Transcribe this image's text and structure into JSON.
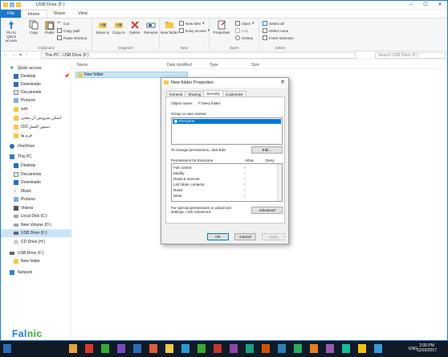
{
  "window": {
    "title": "USB Drive (F:)"
  },
  "ribbon_tabs": [
    "File",
    "Home",
    "Share",
    "View"
  ],
  "ribbon": {
    "clipboard": {
      "pin": "Pin to Quick access",
      "copy": "Copy",
      "paste": "Paste",
      "cut": "Cut",
      "copy_path": "Copy path",
      "paste_shortcut": "Paste shortcut",
      "label": "Clipboard"
    },
    "organize": {
      "move_to": "Move to",
      "copy_to": "Copy to",
      "delete": "Delete",
      "rename": "Rename",
      "label": "Organize"
    },
    "new": {
      "new_folder": "New folder",
      "new_item": "New item",
      "easy_access": "Easy access",
      "label": "New"
    },
    "open": {
      "properties": "Properties",
      "open": "Open",
      "edit": "Edit",
      "history": "History",
      "label": "Open"
    },
    "select": {
      "select_all": "Select all",
      "select_none": "Select none",
      "invert": "Invert selection",
      "label": "Select"
    }
  },
  "address": {
    "path": "This PC  ›  USB Drive (F:)",
    "search_placeholder": "Search USB Drive (F:)",
    "up": "↑"
  },
  "nav": {
    "quick_access": "Quick access",
    "items": [
      "Desktop",
      "Downloads",
      "Documents",
      "Pictures",
      "soft",
      "اسکن سرویس ان مختی",
      "ISO دستور العمل",
      "فرم ها"
    ],
    "onedrive": "OneDrive",
    "this_pc": "This PC",
    "pc_items": [
      "Desktop",
      "Documents",
      "Downloads",
      "Music",
      "Pictures",
      "Videos",
      "Local Disk (C:)",
      "New Volume (D:)",
      "USB Drive (F:)",
      "CD Drive (H:)"
    ],
    "usb": "USB Drive (F:)",
    "usb_child": "New folder",
    "network": "Network"
  },
  "columns": [
    "Name",
    "Date modified",
    "Type",
    "Size"
  ],
  "rows": [
    {
      "name": "New folder"
    }
  ],
  "dialog": {
    "title": "New folder Properties",
    "tabs": [
      "General",
      "Sharing",
      "Security",
      "Customize"
    ],
    "object_name_label": "Object name:",
    "object_name": "F:\\New folder",
    "group_label": "Group or user names:",
    "group_selected": "Everyone",
    "change_text": "To change permissions, click Edit.",
    "edit_button": "Edit...",
    "perm_label": "Permissions for Everyone",
    "allow": "Allow",
    "deny": "Deny",
    "permissions": [
      "Full control",
      "Modify",
      "Read & execute",
      "List folder contents",
      "Read",
      "Write"
    ],
    "special_text": "For special permissions or advanced settings, click Advanced.",
    "advanced_button": "Advanced",
    "ok": "OK",
    "cancel": "Cancel",
    "apply": "Apply"
  },
  "taskbar": {
    "lang": "ENG",
    "time": "2:05 PM",
    "date": "12/20/2017"
  },
  "watermark": {
    "a": "Fal",
    "b": "nic"
  },
  "colors": {
    "accent": "#1979ca",
    "selection": "#cce4f7",
    "taskbar": "#101a26",
    "folder": "#f5c84c"
  }
}
